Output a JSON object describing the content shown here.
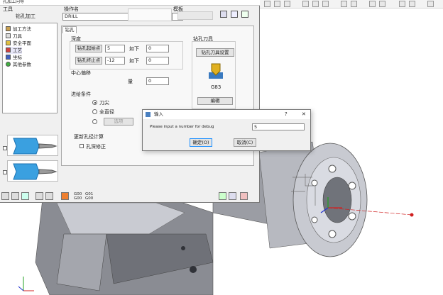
{
  "window": {
    "title": "孔加工向导"
  },
  "left": {
    "header_label": "工具",
    "sub_label": "钻孔加工",
    "tree_items": [
      "加工方法",
      "刀具",
      "安全平面",
      "工艺",
      "坐标",
      "其他参数"
    ]
  },
  "top": {
    "operation_label": "操作名",
    "operation_value": "DRILL",
    "template_label": "模板"
  },
  "tabs": [
    {
      "label": "钻孔"
    }
  ],
  "params": {
    "group_label": "深度",
    "fields": [
      {
        "label": "钻孔起始点",
        "value": "5",
        "suffix": "如下",
        "extra": "0"
      },
      {
        "label": "钻孔终止点",
        "value": "-12",
        "suffix": "如下",
        "extra": "0"
      }
    ],
    "min_label": "中心偏移",
    "min_sub": "量",
    "min_value": "0",
    "approach_label": "进给条件",
    "radios": [
      {
        "label": "刀尖",
        "selected": true
      },
      {
        "label": "全直径",
        "selected": false
      },
      {
        "label": "",
        "selected": false
      }
    ],
    "radio_button": "选项",
    "regen_label": "更新孔径计算",
    "checkbox_label": "孔深修正"
  },
  "right_box": {
    "title": "钻孔刀具",
    "button": "钻孔刀具设置",
    "icon_label": "G83",
    "edit_button": "编辑"
  },
  "bottom_bar": {
    "gcode1": "G00 G00",
    "gcode2": "G01 G00"
  },
  "dialog": {
    "title": "输入",
    "help": "?",
    "close": "✕",
    "prompt": "Please input a number for debug",
    "value": "5",
    "ok_label": "确定(O)",
    "cancel_label": "取消(C)"
  },
  "colors": {
    "accent": "#1e90ff",
    "tree_selected": "#e8e8f8",
    "axis_red": "#d02020",
    "axis_green": "#20a020",
    "axis_blue": "#2030d0"
  }
}
